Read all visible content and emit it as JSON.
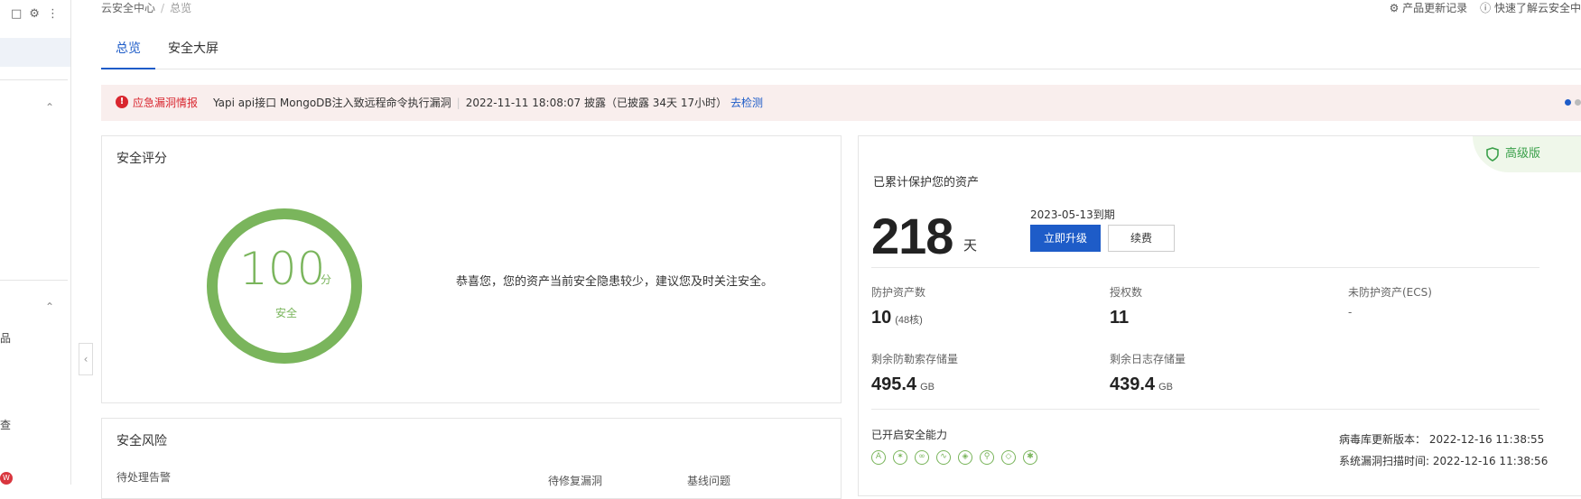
{
  "breadcrumb": {
    "root": "云安全中心",
    "separator": "/",
    "current": "总览"
  },
  "topright": {
    "changelog": "产品更新记录",
    "quick": "快速了解云安全中"
  },
  "tabs": [
    {
      "label": "总览"
    },
    {
      "label": "安全大屏"
    }
  ],
  "sidebar": {
    "frag1": "品",
    "frag2": "查",
    "badge": "W"
  },
  "alert": {
    "type": "应急漏洞情报",
    "title": "Yapi api接口 MongoDB注入致远程命令执行漏洞",
    "time": "2022-11-11 18:08:07 披露（已披露 34天 17小时）",
    "link": "去检测"
  },
  "score": {
    "title": "安全评分",
    "value": "100",
    "unit": "分",
    "level": "安全",
    "message": "恭喜您，您的资产当前安全隐患较少，建议您及时关注安全。"
  },
  "risk": {
    "title": "安全风险",
    "sub1": "待处理告警",
    "sub2": "待修复漏洞",
    "sub3": "基线问题"
  },
  "assets": {
    "title": "已累计保护您的资产",
    "edition": "高级版",
    "days": "218",
    "days_unit": "天",
    "expire": "2023-05-13到期",
    "upgrade_btn": "立即升级",
    "renew_btn": "续费",
    "protected_label": "防护资产数",
    "protected_value": "10",
    "protected_cores": "(48核)",
    "auth_label": "授权数",
    "auth_value": "11",
    "unprotected_label": "未防护资产(ECS)",
    "unprotected_value": "-",
    "ransom_label": "剩余防勒索存储量",
    "ransom_value": "495.4",
    "ransom_unit": "GB",
    "log_label": "剩余日志存储量",
    "log_value": "439.4",
    "log_unit": "GB",
    "capability_title": "已开启安全能力",
    "virus_label": "病毒库更新版本：",
    "virus_value": "2022-12-16 11:38:55",
    "scan_label": "系统漏洞扫描时间:",
    "scan_value": "2022-12-16 11:38:56"
  },
  "colors": {
    "accent": "#1e5cc8",
    "safe": "#7ab55c",
    "danger": "#d9262f",
    "alert_bg": "#f9eeed"
  }
}
